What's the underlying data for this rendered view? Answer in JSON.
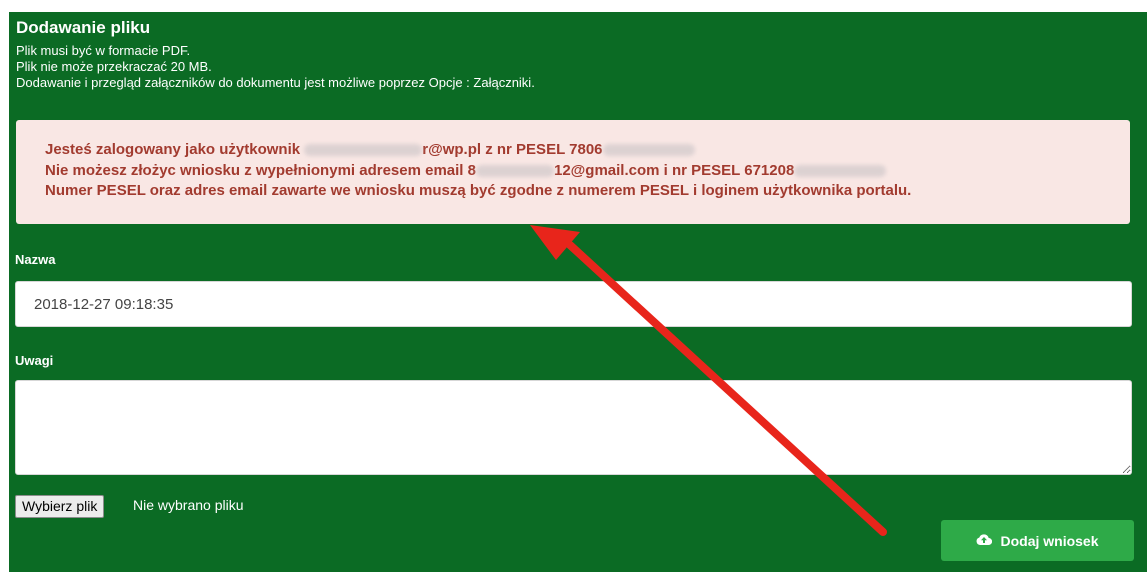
{
  "form": {
    "title": "Dodawanie pliku",
    "info_lines": [
      "Plik musi być w formacie PDF.",
      "Plik nie może przekraczać 20 MB.",
      "Dodawanie i przegląd załączników do dokumentu jest możliwe poprzez Opcje : Załączniki."
    ]
  },
  "alert": {
    "line1_prefix": "Jesteś zalogowany jako użytkownik ",
    "line1_email_suffix": "r@wp.pl",
    "line1_pesel_label": " z nr PESEL ",
    "line1_pesel_visible": "7806",
    "line2_prefix": "Nie możesz złożyc wniosku z wypełnionymi adresem email ",
    "line2_email_start": "8",
    "line2_email_suffix": "12@gmail.com",
    "line2_pesel_label": " i nr PESEL ",
    "line2_pesel_visible": "671208",
    "line3": "Numer PESEL oraz adres email zawarte we wniosku muszą być zgodne z numerem PESEL i loginem użytkownika portalu.",
    "colors": {
      "background": "#f9e7e4",
      "text": "#a23b2f"
    }
  },
  "fields": {
    "nazwa_label": "Nazwa",
    "nazwa_value": "2018-12-27 09:18:35",
    "uwagi_label": "Uwagi",
    "uwagi_value": ""
  },
  "file": {
    "button_label": "Wybierz plik",
    "status": "Nie wybrano pliku"
  },
  "submit": {
    "label": "Dodaj wniosek",
    "icon": "cloud-upload-icon",
    "color": "#2eaa48"
  },
  "annotation": {
    "icon": "red-arrow-icon",
    "color": "#e8251b"
  },
  "colors": {
    "panel": "#0b6b24"
  }
}
